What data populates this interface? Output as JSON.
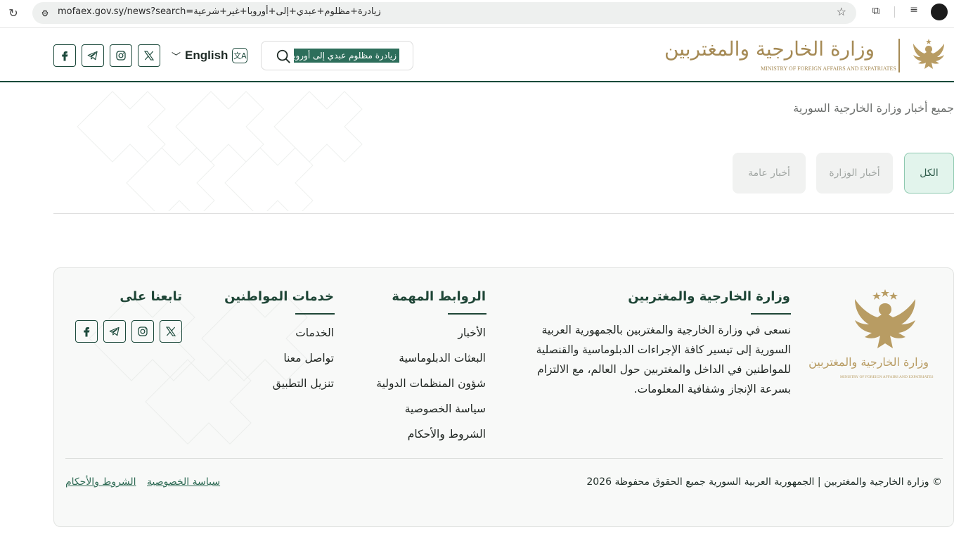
{
  "browser": {
    "url": "mofaex.gov.sy/news?search=زيادرة+مظلوم+عبدي+إلى+أوروبا+غير+شرعية"
  },
  "header": {
    "language_label": "English",
    "search_value": "زيادرة مظلوم عبدي إلى أوروبا غ",
    "logo_ar": "وزارة الخارجية والمغتربين",
    "logo_en": "MINISTRY OF FOREIGN AFFAIRS AND EXPATRIATES",
    "social": [
      "facebook-icon",
      "telegram-icon",
      "instagram-icon",
      "x-icon"
    ]
  },
  "page": {
    "heading": "جميع أخبار وزارة الخارجية السورية",
    "filters": [
      "الكل",
      "أخبار الوزارة",
      "أخبار عامة"
    ]
  },
  "footer": {
    "logo_ar": "وزارة الخارجية والمغتربين",
    "logo_en": "MINISTRY OF FOREIGN AFFAIRS AND EXPATRIATES",
    "about_title": "وزارة الخارجية والمغتربين",
    "about_text": "نسعى في وزارة الخارجية والمغتربين بالجمهورية العربية السورية إلى تيسير كافة الإجراءات الدبلوماسية والقنصلية للمواطنين في الداخل والمغتربين حول العالم، مع الالتزام بسرعة الإنجاز وشفافية المعلومات.",
    "links_title": "الروابط المهمة",
    "links": [
      "الأخبار",
      "البعثات الدبلوماسية",
      "شؤون المنظمات الدولية",
      "سياسة الخصوصية",
      "الشروط والأحكام"
    ],
    "services_title": "خدمات المواطنين",
    "services": [
      "الخدمات",
      "تواصل معنا",
      "تنزيل التطبيق"
    ],
    "follow_title": "تابعنا على",
    "copyright": "© وزارة الخارجية والمغتربين | الجمهورية العربية السورية جميع الحقوق محفوظة 2026",
    "privacy_link": "سياسة الخصوصية",
    "terms_link": "الشروط والأحكام"
  },
  "colors": {
    "brand_green": "#0f4a3a",
    "gold": "#a58a55",
    "active_filter_bg": "#e2f4ec"
  }
}
